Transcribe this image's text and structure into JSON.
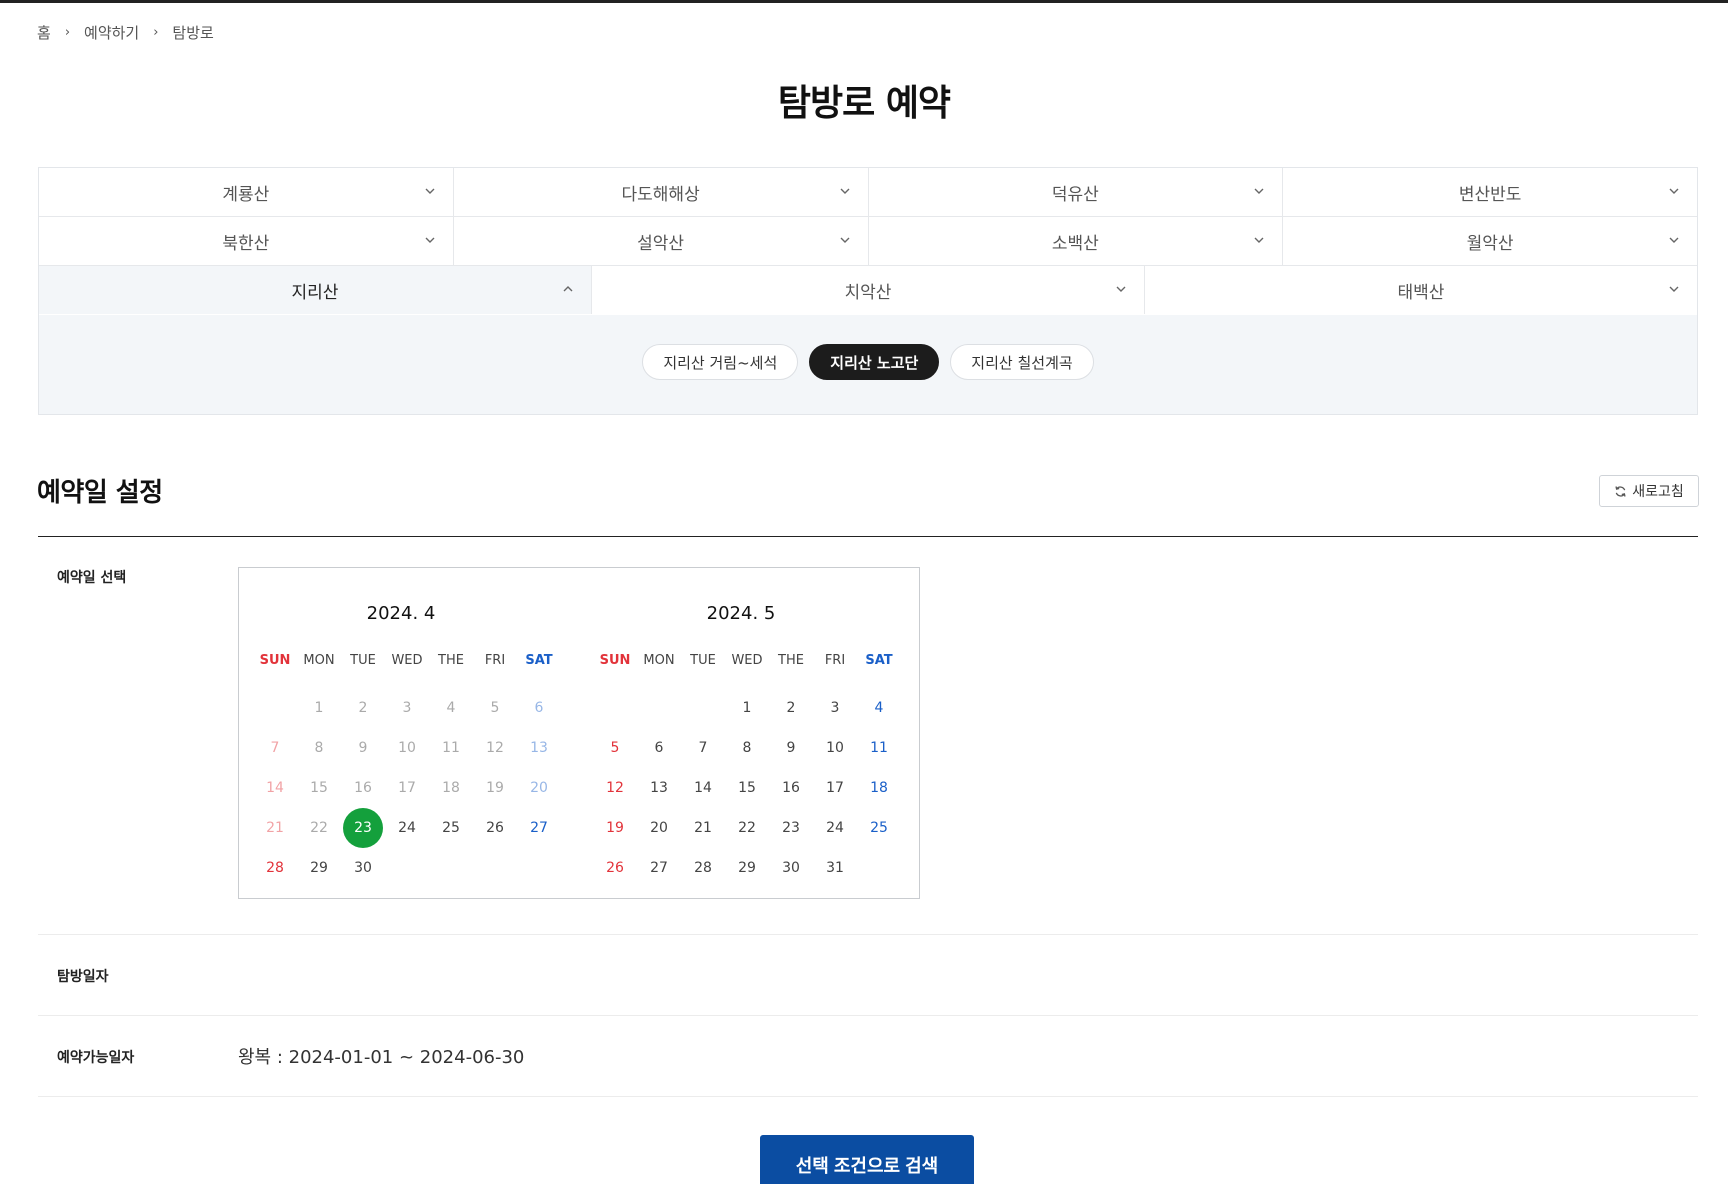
{
  "breadcrumb": {
    "home": "홈",
    "level1": "예약하기",
    "level2": "탐방로"
  },
  "page_title": "탐방로 예약",
  "regions": {
    "row1": [
      "계룡산",
      "다도해해상",
      "덕유산",
      "변산반도"
    ],
    "row2": [
      "북한산",
      "설악산",
      "소백산",
      "월악산"
    ],
    "row3": [
      "지리산",
      "치악산",
      "태백산"
    ],
    "active": "지리산"
  },
  "trails": {
    "items": [
      "지리산 거림~세석",
      "지리산 노고단",
      "지리산 칠선계곡"
    ],
    "selected": "지리산 노고단"
  },
  "date_section": {
    "title": "예약일 설정",
    "refresh_label": "새로고침",
    "select_label": "예약일 선택",
    "visit_date_label": "탐방일자",
    "available_label": "예약가능일자",
    "available_value": "왕복 : 2024-01-01 ~ 2024-06-30"
  },
  "calendar": {
    "weekdays": [
      "SUN",
      "MON",
      "TUE",
      "WED",
      "THE",
      "FRI",
      "SAT"
    ],
    "months": [
      {
        "title": "2024. 4",
        "first_weekday": 1,
        "days": 30,
        "past_until": 22,
        "today": 23
      },
      {
        "title": "2024. 5",
        "first_weekday": 3,
        "days": 31,
        "past_until": 0,
        "today": null
      }
    ]
  },
  "colors": {
    "accent_green": "#14a03c",
    "primary_blue": "#0b4da2",
    "sunday_red": "#e2333a",
    "saturday_blue": "#1a5fc8"
  },
  "search_button_label": "선택 조건으로 검색"
}
